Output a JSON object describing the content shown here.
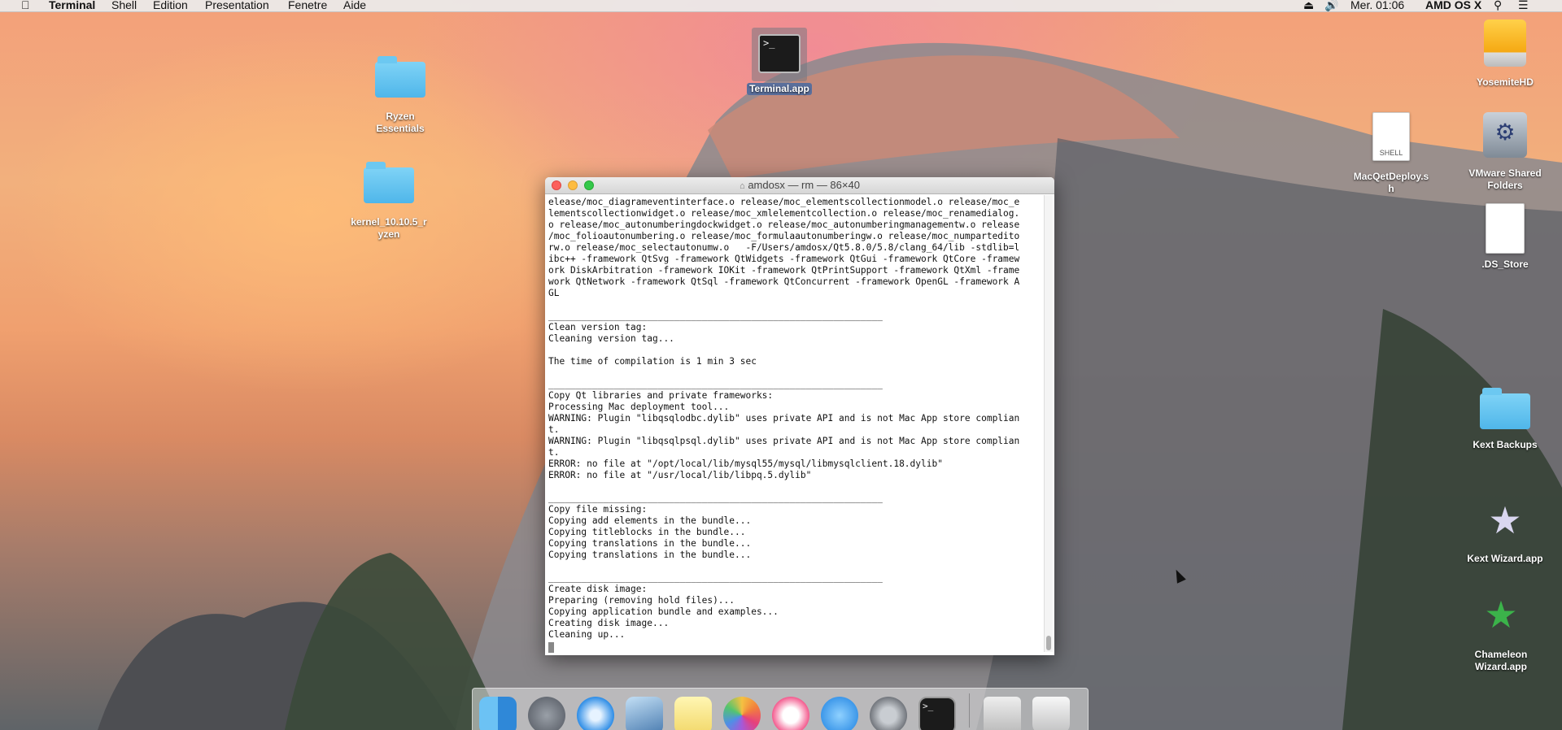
{
  "menubar": {
    "app_name": "Terminal",
    "menus": [
      "Shell",
      "Edition",
      "Presentation",
      "Fenetre",
      "Aide"
    ],
    "clock": "Mer. 01:06",
    "user": "AMD OS X"
  },
  "desktop_icons": {
    "ryzen": "Ryzen\nEssentials",
    "kernel": "kernel_10.10.5_r\nyzen",
    "terminal_app": "Terminal.app",
    "yosemite_hd": "YosemiteHD",
    "mac_qet_deploy": "MacQetDeploy.s\nh",
    "mac_qet_tag": "SHELL",
    "vmware": "VMware Shared\nFolders",
    "ds_store": ".DS_Store",
    "kext_backups": "Kext Backups",
    "kext_wizard": "Kext Wizard.app",
    "chameleon": "Chameleon\nWizard.app"
  },
  "terminal": {
    "title": "amdosx — rm — 86×40",
    "output": "elease/moc_diagrameventinterface.o release/moc_elementscollectionmodel.o release/moc_e\nlementscollectionwidget.o release/moc_xmlelementcollection.o release/moc_renamedialog.\no release/moc_autonumberingdockwidget.o release/moc_autonumberingmanagementw.o release\n/moc_folioautonumbering.o release/moc_formulaautonumberingw.o release/moc_numparteditо\nrw.o release/moc_selectautonumw.o   -F/Users/amdosx/Qt5.8.0/5.8/clang_64/lib -stdlib=l\nibc++ -framework QtSvg -framework QtWidgets -framework QtGui -framework QtCore -framew\nork DiskArbitration -framework IOKit -framework QtPrintSupport -framework QtXml -frame\nwork QtNetwork -framework QtSql -framework QtConcurrent -framework OpenGL -framework A\nGL\n\n_____________________________________________________________\nClean version tag:\nCleaning version tag...\n\nThe time of compilation is 1 min 3 sec\n\n_____________________________________________________________\nCopy Qt libraries and private frameworks:\nProcessing Mac deployment tool...\nWARNING: Plugin \"libqsqlodbc.dylib\" uses private API and is not Mac App store complian\nt.\nWARNING: Plugin \"libqsqlpsql.dylib\" uses private API and is not Mac App store complian\nt.\nERROR: no file at \"/opt/local/lib/mysql55/mysql/libmysqlclient.18.dylib\"\nERROR: no file at \"/usr/local/lib/libpq.5.dylib\"\n\n_____________________________________________________________\nCopy file missing:\nCopying add elements in the bundle...\nCopying titleblocks in the bundle...\nCopying translations in the bundle...\nCopying translations in the bundle...\n\n_____________________________________________________________\nCreate disk image:\nPreparing (removing hold files)...\nCopying application bundle and examples...\nCreating disk image...\nCleaning up..."
  },
  "dock": {
    "items": [
      "finder-icon",
      "launchpad-icon",
      "safari-icon",
      "preview-icon",
      "notes-icon",
      "photos-icon",
      "itunes-icon",
      "app-store-icon",
      "system-preferences-icon",
      "terminal-icon",
      "installer-icon",
      "trash-icon"
    ]
  },
  "colors": {
    "traffic_close": "#fc605c",
    "traffic_min": "#fdbc40",
    "traffic_max": "#34c84a",
    "folder_blue": "#4fb6ea"
  }
}
